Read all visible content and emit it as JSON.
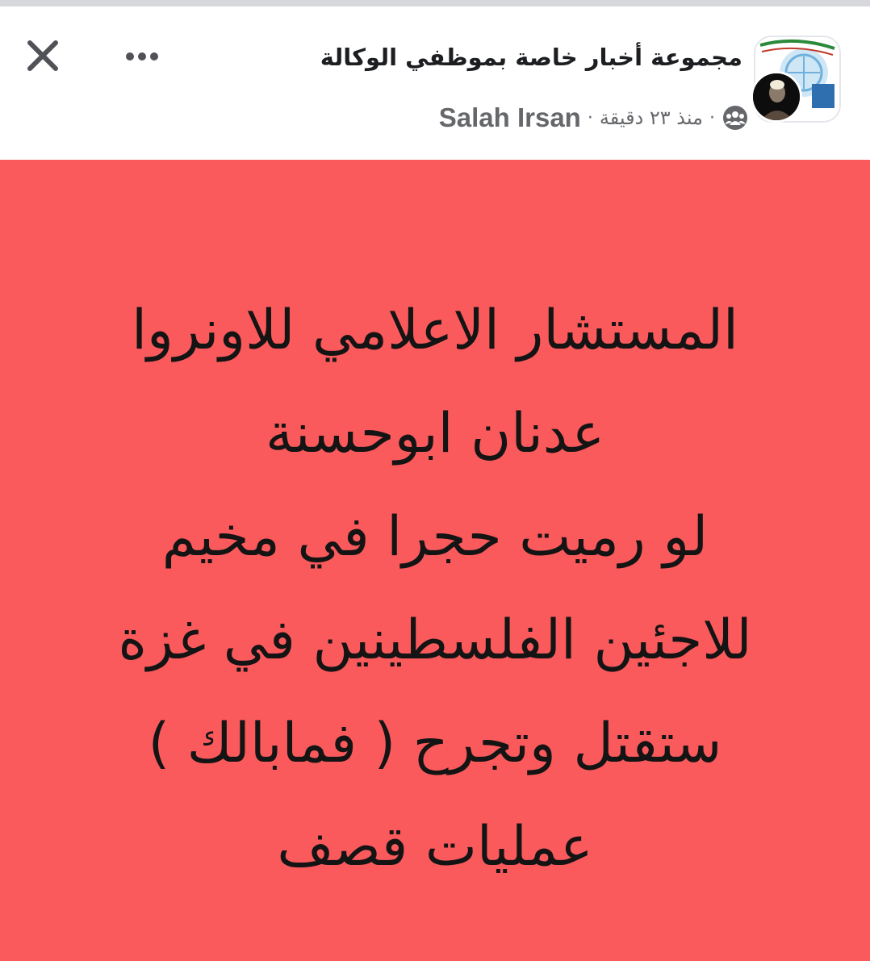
{
  "header": {
    "group_title": "مجموعة أخبار خاصة بموظفي الوكالة",
    "author": "Salah Irsan",
    "time": "منذ ٢٣ دقيقة",
    "separator": "·",
    "icons": {
      "close": "close-icon",
      "more": "more-options-icon",
      "audience": "group-audience-icon"
    }
  },
  "post": {
    "background_color": "#fa5a5c",
    "lines": [
      "المستشار الاعلامي للاونروا",
      "عدنان ابوحسنة",
      "لو رميت حجرا في مخيم",
      "للاجئين الفلسطينين في غزة",
      "ستقتل وتجرح ( فمابالك )",
      "عمليات  قصف"
    ]
  }
}
